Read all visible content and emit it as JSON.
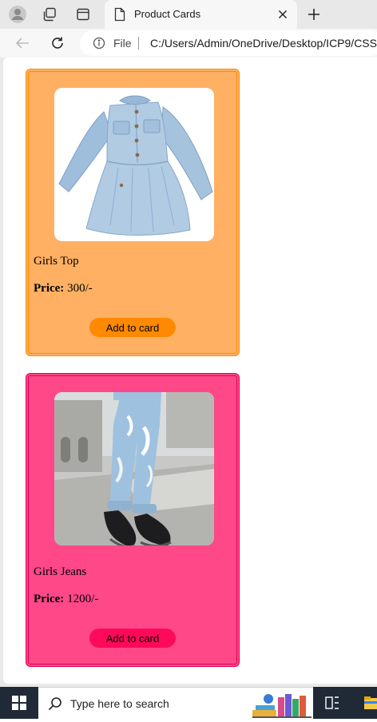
{
  "browser": {
    "tab_title": "Product Cards",
    "address_label": "File",
    "url": "C:/Users/Admin/OneDrive/Desktop/ICP9/CSS/"
  },
  "products": [
    {
      "name": "Girls Top",
      "price_label": "Price:",
      "price_value": " 300/-",
      "button": "Add to card",
      "bg_color": "#ffb062",
      "border_color": "#ff8a00",
      "button_color": "#ff8a00"
    },
    {
      "name": "Girls Jeans",
      "price_label": "Price:",
      "price_value": " 1200/-",
      "button": "Add to card",
      "bg_color": "#ff4888",
      "border_color": "#e0005a",
      "button_color": "#ff0a5a"
    }
  ],
  "taskbar": {
    "search_placeholder": "Type here to search"
  }
}
